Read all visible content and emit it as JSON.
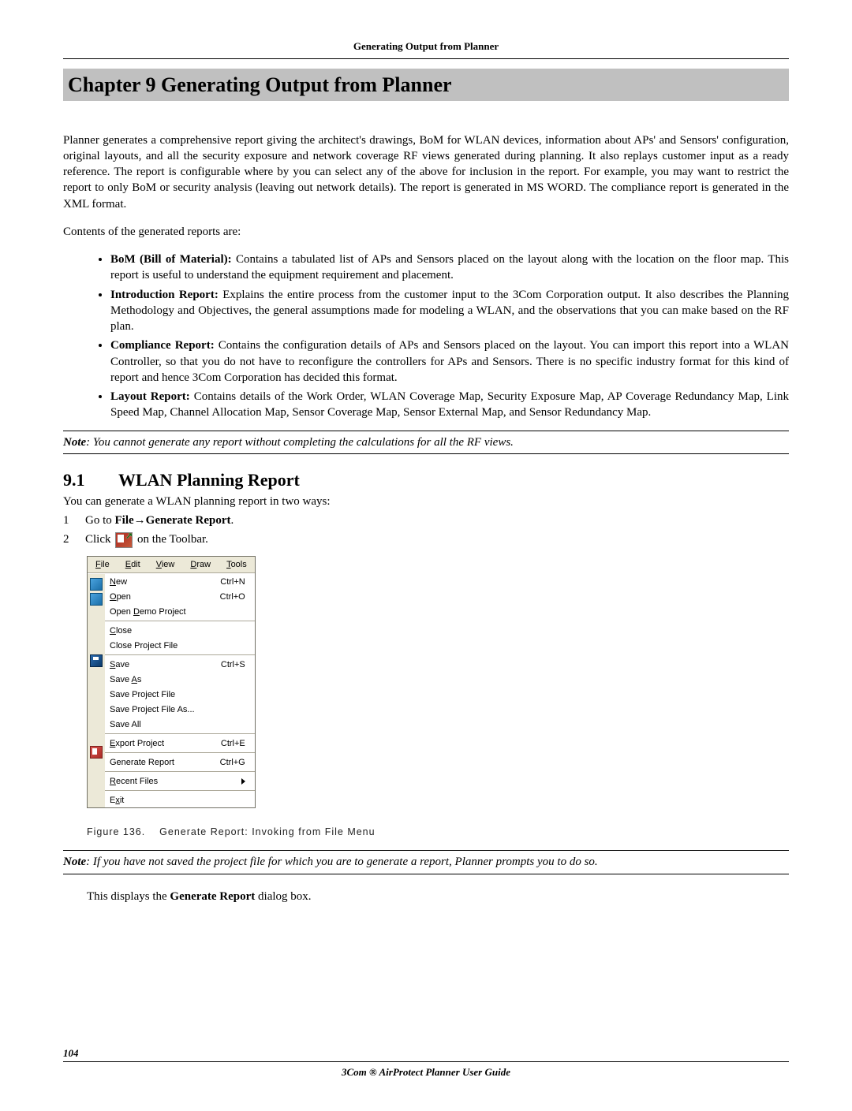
{
  "running_header": "Generating Output from Planner",
  "chapter_title": "Chapter 9       Generating Output from Planner",
  "intro_para": "Planner generates a comprehensive report giving the architect's drawings, BoM for WLAN devices, information about APs' and Sensors' configuration, original layouts, and all the security exposure and network coverage RF views generated during planning. It also replays customer input as a ready reference. The report is configurable where by you can select any of the above for inclusion in the report. For example, you may want to restrict the report to only BoM or security analysis (leaving out network details). The report is generated in MS WORD. The compliance report is generated in the XML format.",
  "contents_intro": "Contents of the generated reports are:",
  "bullets": {
    "bom_label": "BoM (Bill of Material):",
    "bom_text": " Contains a tabulated list of APs and Sensors placed on the layout along with the location on the floor map. This report is useful to understand the equipment requirement and placement.",
    "intro_label": "Introduction Report:",
    "intro_text": " Explains the entire process from the customer input to the 3Com Corporation output. It also describes the Planning Methodology and Objectives, the general assumptions made for modeling a WLAN, and the observations that you can make based on the RF plan.",
    "comp_label": "Compliance Report:",
    "comp_text": " Contains the configuration details of APs and Sensors placed on the layout. You can import this report into a WLAN Controller, so that you do not have to reconfigure the controllers for APs and Sensors. There is no specific industry format for this kind of report and hence 3Com Corporation has decided this format.",
    "layout_label": "Layout Report:",
    "layout_text": " Contains details of the Work Order, WLAN Coverage Map, Security Exposure Map, AP Coverage Redundancy Map, Link Speed Map, Channel Allocation Map, Sensor Coverage Map, Sensor External Map, and Sensor Redundancy Map."
  },
  "note1_label": "Note",
  "note1_text": ": You cannot generate any report without completing the calculations for all the RF views.",
  "section_num": "9.1",
  "section_title": "WLAN Planning Report",
  "two_ways": "You can generate a WLAN planning report in two ways:",
  "step1_num": "1",
  "step1_prefix": "Go to ",
  "step1_bold1": "File",
  "step1_arrow": "→",
  "step1_bold2": "Generate Report",
  "step1_suffix": ".",
  "step2_num": "2",
  "step2_prefix": "Click ",
  "step2_suffix": " on the Toolbar.",
  "menu": {
    "bar": {
      "file": "File",
      "edit": "Edit",
      "view": "View",
      "draw": "Draw",
      "tools": "Tools",
      "file_u": "F",
      "edit_u": "E",
      "view_u": "V",
      "draw_u": "D",
      "tools_u": "T"
    },
    "new": "New",
    "new_s": "Ctrl+N",
    "new_u": "N",
    "open": "Open",
    "open_s": "Ctrl+O",
    "open_u": "O",
    "open_demo": "Open Demo Project",
    "open_demo_u": "D",
    "close": "Close",
    "close_u": "C",
    "close_pf": "Close Project File",
    "save": "Save",
    "save_s": "Ctrl+S",
    "save_u": "S",
    "save_as": "Save As",
    "save_as_u": "A",
    "save_pf": "Save Project File",
    "save_pf_as": "Save Project File As...",
    "save_all": "Save All",
    "export": "Export Project",
    "export_s": "Ctrl+E",
    "export_u": "E",
    "gen": "Generate Report",
    "gen_s": "Ctrl+G",
    "recent": "Recent Files",
    "recent_u": "R",
    "exit": "Exit",
    "exit_u": "x"
  },
  "figure_num": "Figure 136.",
  "figure_caption": "Generate Report: Invoking from File Menu",
  "note2_label": "Note",
  "note2_text": ": If you have not saved the project file for which you are to generate a report, Planner prompts you to do so.",
  "display_prefix": "This displays the ",
  "display_bold": "Generate Report",
  "display_suffix": " dialog box.",
  "page_num": "104",
  "footer_title": "3Com ® AirProtect Planner User Guide"
}
